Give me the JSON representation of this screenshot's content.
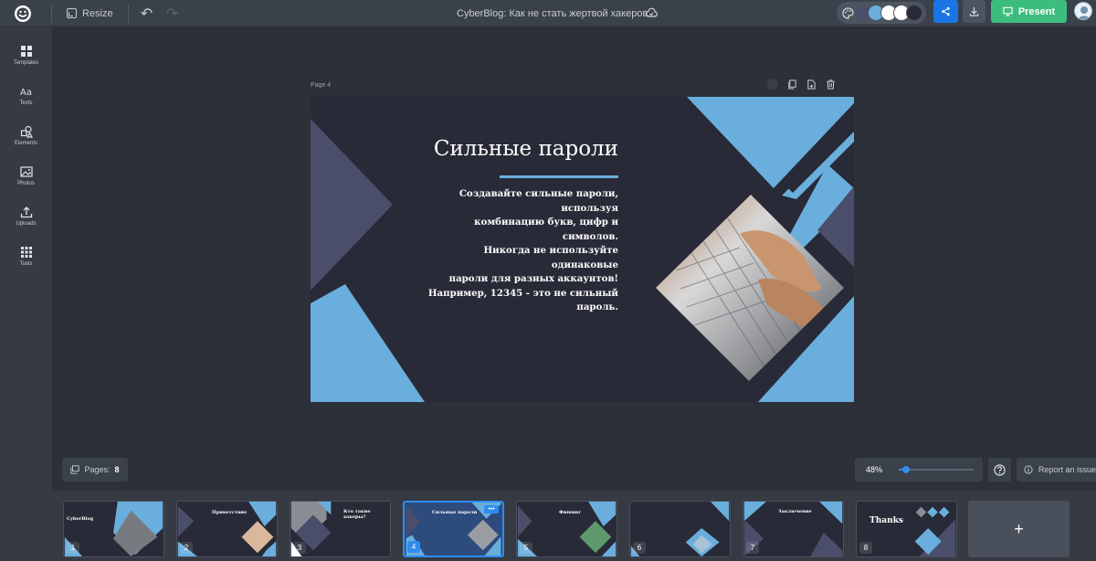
{
  "topbar": {
    "resize_label": "Resize",
    "document_title": "CyberBlog: Как не стать жертвой хакеров...",
    "present_label": "Present",
    "theme_colors": [
      "#4a4e6a",
      "#6aaedd",
      "#ffffff",
      "#ffffff",
      "#282a37"
    ]
  },
  "sidebar": {
    "items": [
      {
        "label": "Templates",
        "icon": "templates-icon"
      },
      {
        "label": "Texts",
        "icon": "text-icon"
      },
      {
        "label": "Elements",
        "icon": "elements-icon"
      },
      {
        "label": "Photos",
        "icon": "photo-icon"
      },
      {
        "label": "Uploads",
        "icon": "upload-icon"
      },
      {
        "label": "Tools",
        "icon": "tools-icon"
      }
    ]
  },
  "canvas": {
    "page_label": "Page 4",
    "slide": {
      "title": "Сильные пароли",
      "body_lines": [
        "Создавайте сильные пароли, используя",
        "комбинацию букв, цифр и символов.",
        "Никогда не используйте одинаковые",
        "пароли для разных аккаунтов!",
        "Например, 12345 - это не сильный",
        "пароль."
      ],
      "colors": {
        "background": "#282a37",
        "accent": "#6aaedd",
        "secondary": "#4a4e6a"
      }
    }
  },
  "bottom": {
    "pages_label": "Pages:",
    "pages_count": "8",
    "zoom": "48%",
    "zoom_fraction": 0.1,
    "report_label": "Report an issue"
  },
  "thumbnails": [
    {
      "number": "1",
      "title": "CyberBlog"
    },
    {
      "number": "2",
      "title": "Приветствие"
    },
    {
      "number": "3",
      "title": "Кто такие хакеры?"
    },
    {
      "number": "4",
      "title": "Сильные пароли",
      "active": true
    },
    {
      "number": "5",
      "title": "Фишинг"
    },
    {
      "number": "6",
      "title": ""
    },
    {
      "number": "7",
      "title": "Заключение"
    },
    {
      "number": "8",
      "title": "Thanks"
    }
  ],
  "add_page_label": "+"
}
